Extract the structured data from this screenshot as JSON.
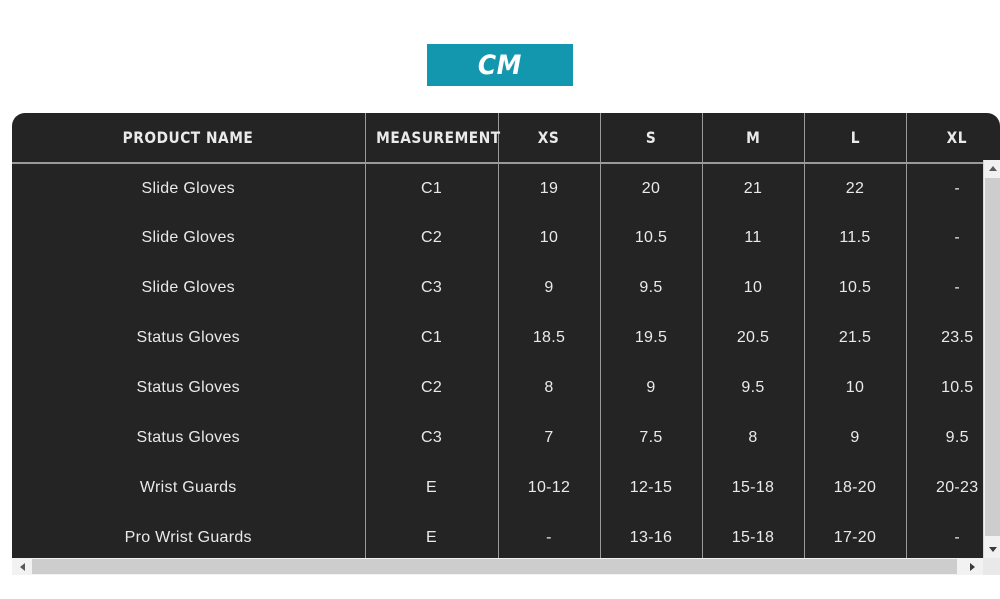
{
  "tabs": {
    "active_unit": "CM"
  },
  "colors": {
    "accent_teal": "#1297ae",
    "table_background": "#242424",
    "divider": "#9a9a9a",
    "text": "#e9e9e9",
    "page_background": "#ffffff"
  },
  "table": {
    "headers": [
      "PRODUCT NAME",
      "MEASUREMENT",
      "XS",
      "S",
      "M",
      "L",
      "XL"
    ],
    "rows": [
      {
        "product": "Slide Gloves",
        "measurement": "C1",
        "xs": "19",
        "s": "20",
        "m": "21",
        "l": "22",
        "xl": "-"
      },
      {
        "product": "Slide Gloves",
        "measurement": "C2",
        "xs": "10",
        "s": "10.5",
        "m": "11",
        "l": "11.5",
        "xl": "-"
      },
      {
        "product": "Slide Gloves",
        "measurement": "C3",
        "xs": "9",
        "s": "9.5",
        "m": "10",
        "l": "10.5",
        "xl": "-"
      },
      {
        "product": "Status Gloves",
        "measurement": "C1",
        "xs": "18.5",
        "s": "19.5",
        "m": "20.5",
        "l": "21.5",
        "xl": "23.5"
      },
      {
        "product": "Status Gloves",
        "measurement": "C2",
        "xs": "8",
        "s": "9",
        "m": "9.5",
        "l": "10",
        "xl": "10.5"
      },
      {
        "product": "Status Gloves",
        "measurement": "C3",
        "xs": "7",
        "s": "7.5",
        "m": "8",
        "l": "9",
        "xl": "9.5"
      },
      {
        "product": "Wrist Guards",
        "measurement": "E",
        "xs": "10-12",
        "s": "12-15",
        "m": "15-18",
        "l": "18-20",
        "xl": "20-23"
      },
      {
        "product": "Pro Wrist Guards",
        "measurement": "E",
        "xs": "-",
        "s": "13-16",
        "m": "15-18",
        "l": "17-20",
        "xl": "-"
      }
    ]
  },
  "scrollbars": {
    "vertical_up_icon": "triangle-up-icon",
    "vertical_down_icon": "triangle-down-icon",
    "horizontal_left_icon": "triangle-left-icon",
    "horizontal_right_icon": "triangle-right-icon"
  }
}
